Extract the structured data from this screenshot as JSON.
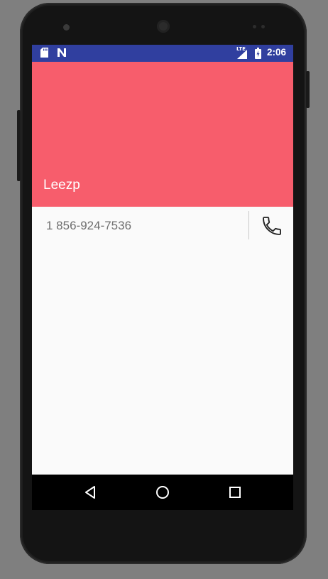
{
  "status_bar": {
    "time": "2:06",
    "network_label": "LTE",
    "icons": [
      "sd-card-icon",
      "n-notification-icon",
      "signal-icon",
      "battery-icon"
    ],
    "color": "#303f9f"
  },
  "contact": {
    "name": "Leezp",
    "phone": "1 856-924-7536",
    "header_color": "#f75d6c"
  },
  "nav_bar": {
    "buttons": [
      "back-icon",
      "home-icon",
      "recents-icon"
    ]
  }
}
